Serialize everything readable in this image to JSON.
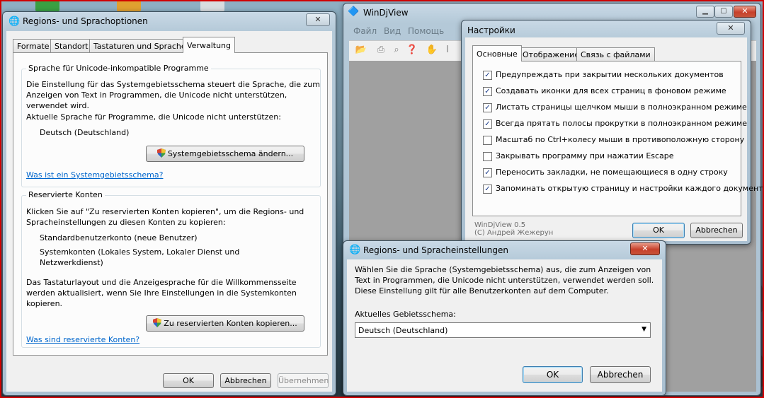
{
  "regional_window": {
    "title": "Regions- und Sprachoptionen",
    "close_label": "✕",
    "tabs": [
      "Formate",
      "Standort",
      "Tastaturen und Sprachen",
      "Verwaltung"
    ],
    "unicode_group": {
      "legend": "Sprache für Unicode-inkompatible Programme",
      "desc_lines": [
        "Die Einstellung für das Systemgebietsschema steuert die Sprache, die zum",
        "Anzeigen von Text in Programmen, die Unicode nicht unterstützen,",
        "verwendet wird."
      ],
      "current_label": "Aktuelle Sprache für Programme, die Unicode nicht unterstützen:",
      "current_value": "Deutsch (Deutschland)",
      "change_button": "Systemgebietsschema ändern...",
      "help_link": "Was ist ein Systemgebietsschema?"
    },
    "reserved_group": {
      "legend": "Reservierte Konten",
      "desc_lines": [
        "Klicken Sie auf \"Zu reservierten Konten kopieren\", um die Regions- und",
        "Spracheinstellungen zu diesen Konten zu kopieren:"
      ],
      "account_1": "Standardbenutzerkonto (neue Benutzer)",
      "account_2_lines": [
        "Systemkonten (Lokales System, Lokaler Dienst und",
        "Netzwerkdienst)"
      ],
      "note_lines": [
        "Das Tastaturlayout und die Anzeigesprache für die Willkommensseite",
        "werden aktualisiert, wenn Sie Ihre Einstellungen in die Systemkonten",
        "kopieren."
      ],
      "copy_button": "Zu reservierten Konten kopieren...",
      "help_link": "Was sind reservierte Konten?"
    },
    "buttons": {
      "ok": "OK",
      "cancel": "Abbrechen",
      "apply": "Übernehmen"
    }
  },
  "windjview": {
    "title": "WinDjView",
    "menu": [
      "Файл",
      "Вид",
      "Помощь"
    ],
    "controls": {
      "minimize": "▁",
      "maximize": "▢",
      "close": "✕"
    }
  },
  "settings_dialog": {
    "title": "Настройки",
    "close_label": "✕",
    "tabs": [
      "Основные",
      "Отображение",
      "Связь с файлами"
    ],
    "options": [
      {
        "label": "Предупреждать при закрытии нескольких документов",
        "checked": true
      },
      {
        "label": "Создавать иконки для всех страниц в фоновом режиме",
        "checked": true
      },
      {
        "label": "Листать страницы щелчком мыши в полноэкранном режиме",
        "checked": true
      },
      {
        "label": "Всегда прятать полосы прокрутки в полноэкранном режиме",
        "checked": true
      },
      {
        "label": "Масштаб по Ctrl+колесу мыши в противоположную сторону",
        "checked": false
      },
      {
        "label": "Закрывать программу при нажатии Escape",
        "checked": false
      },
      {
        "label": "Переносить закладки, не помещающиеся в одну строку",
        "checked": true
      },
      {
        "label": "Запоминать открытую страницу и настройки каждого документа",
        "checked": true
      }
    ],
    "version": "WinDjView 0.5",
    "copyright": "(C) Андрей Жежерун",
    "ok": "OK",
    "cancel": "Abbrechen"
  },
  "locale_dialog": {
    "title": "Regions- und Spracheinstellungen",
    "close_label": "✕",
    "desc_lines": [
      "Wählen Sie die Sprache (Systemgebietsschema) aus, die zum Anzeigen von",
      "Text in Programmen, die Unicode nicht unterstützen, verwendet werden soll.",
      "Diese Einstellung gilt für alle Benutzerkonten auf dem Computer."
    ],
    "current_label": "Aktuelles Gebietsschema:",
    "current_value": "Deutsch (Deutschland)",
    "ok": "OK",
    "cancel": "Abbrechen"
  }
}
